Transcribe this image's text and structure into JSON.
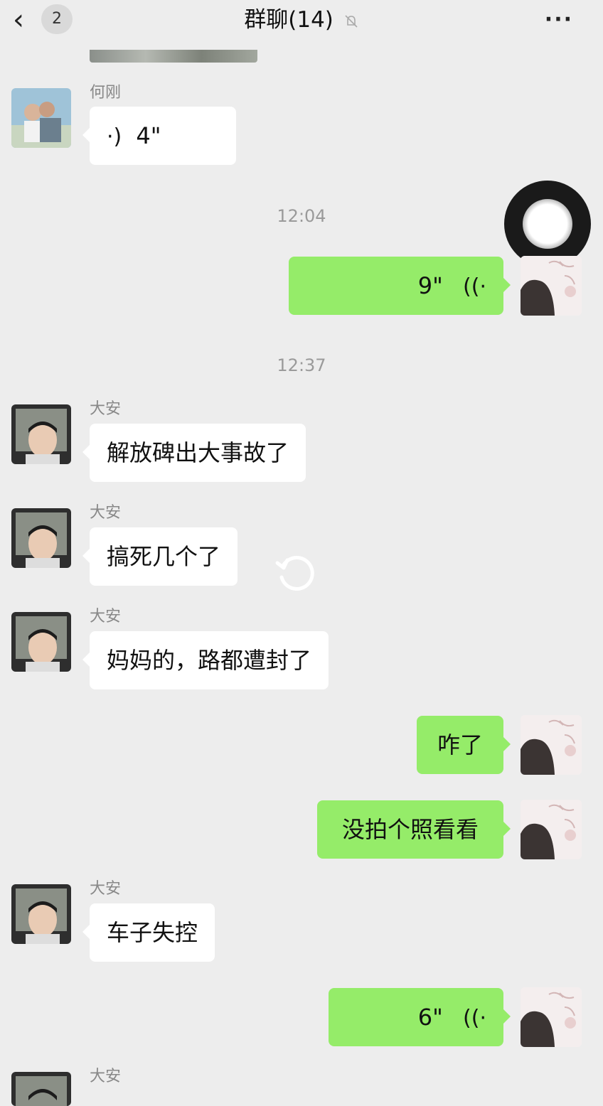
{
  "header": {
    "back_glyph": "‹",
    "unread_count": "2",
    "title": "群聊(14)",
    "more_label": "···"
  },
  "messages": {
    "m1": {
      "sender": "何刚",
      "duration": "4\""
    },
    "t1": "12:04",
    "m2": {
      "duration": "9\""
    },
    "t2": "12:37",
    "m3": {
      "sender": "大安",
      "text": "解放碑出大事故了"
    },
    "m4": {
      "sender": "大安",
      "text": "搞死几个了"
    },
    "m5": {
      "sender": "大安",
      "text": "妈妈的，路都遭封了"
    },
    "m6": {
      "text": "咋了"
    },
    "m7": {
      "text": "没拍个照看看"
    },
    "m8": {
      "sender": "大安",
      "text": "车子失控"
    },
    "m9": {
      "duration": "6\""
    },
    "m10": {
      "sender": "大安"
    }
  },
  "colors": {
    "self_bubble": "#95ec69",
    "background": "#ededed"
  },
  "icons": [
    "back-arrow-icon",
    "mute-icon",
    "more-icon",
    "voice-icon",
    "record-icon",
    "refresh-icon"
  ]
}
